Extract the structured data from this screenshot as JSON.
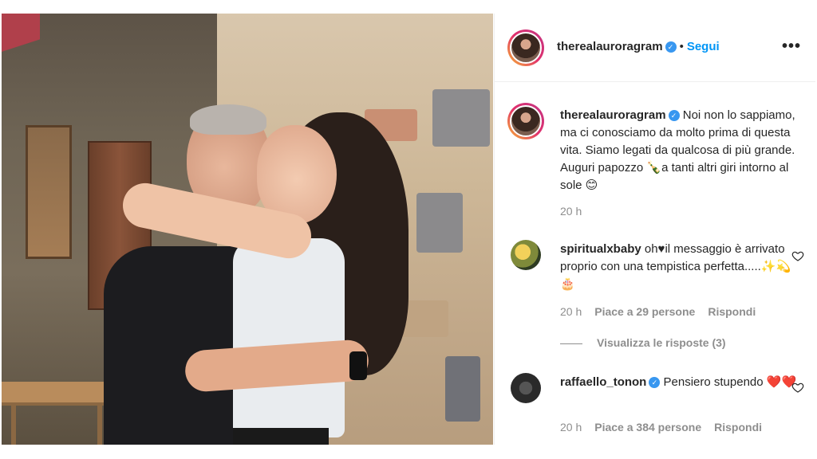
{
  "post": {
    "username": "therealauroragram",
    "follow_label": "Segui",
    "caption": "Noi non lo sappiamo, ma ci conosciamo da molto prima di questa vita. Siamo legati da qualcosa di più grande. Auguri papozzo 🍾a tanti altri giri intorno al sole 😊",
    "time": "20 h"
  },
  "comments": [
    {
      "username": "spiritualxbaby",
      "text": "oh♥il messaggio è arrivato proprio con una tempistica perfetta.....✨💫🎂",
      "time": "20 h",
      "likes": "Piace a 29 persone",
      "reply_label": "Rispondi",
      "view_replies": "Visualizza le risposte (3)"
    },
    {
      "username": "raffaello_tonon",
      "text": "Pensiero stupendo ❤️❤️",
      "time": "20 h",
      "likes": "Piace a 384 persone",
      "reply_label": "Rispondi"
    }
  ],
  "icons": {
    "verified": "verified-badge-icon",
    "more": "more-options-icon",
    "like": "heart-icon"
  },
  "colors": {
    "accent": "#0095f6",
    "verified": "#3897f0",
    "muted": "#8e8e8e",
    "text": "#262626"
  }
}
